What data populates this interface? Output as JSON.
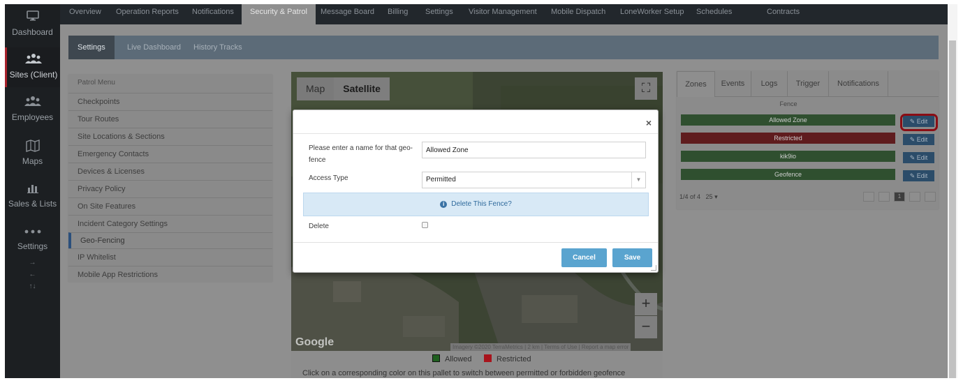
{
  "sidebar": {
    "items": [
      {
        "label": "Dashboard",
        "icon": "monitor-icon"
      },
      {
        "label": "Sites (Client)",
        "icon": "people-group-icon"
      },
      {
        "label": "Employees",
        "icon": "employees-icon"
      },
      {
        "label": "Maps",
        "icon": "map-icon"
      },
      {
        "label": "Sales & Lists",
        "icon": "bar-chart-icon"
      },
      {
        "label": "Settings",
        "icon": "more-dots-icon"
      }
    ],
    "arrows": [
      "→",
      "←",
      "↑↓"
    ]
  },
  "topnav": {
    "tabs": [
      "Overview",
      "Operation Reports",
      "Notifications",
      "Security & Patrol",
      "Message Board",
      "Billing",
      "Settings",
      "Visitor Management",
      "Mobile Dispatch",
      "LoneWorker Setup",
      "Schedules",
      "Contracts"
    ],
    "active": "Security & Patrol"
  },
  "subnav": {
    "tabs": [
      "Settings",
      "Live Dashboard",
      "History Tracks"
    ]
  },
  "patrol_menu": {
    "title": "Patrol Menu",
    "items": [
      "Checkpoints",
      "Tour Routes",
      "Site Locations & Sections",
      "Emergency Contacts",
      "Devices & Licenses",
      "Privacy Policy",
      "On Site Features",
      "Incident Category Settings",
      "Geo-Fencing",
      "IP Whitelist",
      "Mobile App Restrictions"
    ],
    "selected": "Geo-Fencing"
  },
  "map": {
    "type_buttons": [
      "Map",
      "Satellite"
    ],
    "selected_type": "Satellite",
    "zoom_in": "+",
    "zoom_out": "−",
    "logo": "Google",
    "attribution": [
      "Imagery ©2020 TerraMetrics",
      "2 km",
      "Terms of Use",
      "Report a map error"
    ],
    "legend": [
      {
        "label": "Allowed",
        "color": "#1f5f1f"
      },
      {
        "label": "Restricted",
        "color": "#a8141c"
      }
    ],
    "note": "Click on a corresponding color on this pallet to switch between permitted or forbidden geofence"
  },
  "right_panel": {
    "tabs": [
      "Zones",
      "Events",
      "Logs",
      "Trigger",
      "Notifications"
    ],
    "column_header": "Fence",
    "zones": [
      {
        "name": "Allowed Zone",
        "color": "#2f4f2f"
      },
      {
        "name": "Restricted",
        "color": "#5f1c1e"
      },
      {
        "name": "kik9io",
        "color": "#2f4f2f"
      },
      {
        "name": "Geofence",
        "color": "#2f4f2f"
      }
    ],
    "edit_label": "Edit",
    "pager_info": "1/4 of 4",
    "page_size": "25",
    "current_page": "1"
  },
  "modal": {
    "close": "×",
    "name_label": "Please enter a name for that geo-fence",
    "name_value": "Allowed Zone",
    "access_label": "Access Type",
    "access_value": "Permitted",
    "delete_alert": "Delete This Fence?",
    "delete_label": "Delete",
    "cancel_label": "Cancel",
    "save_label": "Save"
  }
}
